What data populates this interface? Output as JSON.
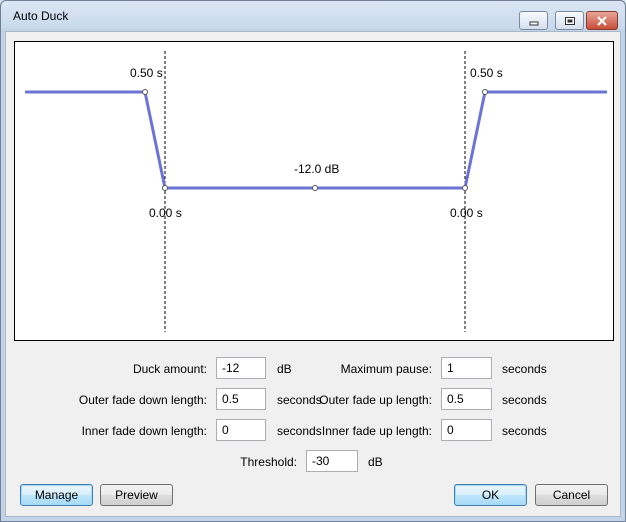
{
  "window": {
    "title": "Auto Duck",
    "controls": [
      "minimize-icon",
      "maximize-icon",
      "close-icon"
    ]
  },
  "graph": {
    "left_outer_label": "0.50 s",
    "right_outer_label": "0.50 s",
    "left_inner_label": "0.00 s",
    "right_inner_label": "0.00 s",
    "amount_label": "-12.0 dB",
    "line_color": "#6b74d4"
  },
  "form": {
    "duck_amount": {
      "label": "Duck amount:",
      "value": "-12",
      "unit": "dB"
    },
    "maximum_pause": {
      "label": "Maximum pause:",
      "value": "1",
      "unit": "seconds"
    },
    "outer_fade_down": {
      "label": "Outer fade down length:",
      "value": "0.5",
      "unit": "seconds"
    },
    "outer_fade_up": {
      "label": "Outer fade up length:",
      "value": "0.5",
      "unit": "seconds"
    },
    "inner_fade_down": {
      "label": "Inner fade down length:",
      "value": "0",
      "unit": "seconds"
    },
    "inner_fade_up": {
      "label": "Inner fade up length:",
      "value": "0",
      "unit": "seconds"
    },
    "threshold": {
      "label": "Threshold:",
      "value": "-30",
      "unit": "dB"
    }
  },
  "buttons": {
    "manage": "Manage",
    "preview": "Preview",
    "ok": "OK",
    "cancel": "Cancel"
  }
}
